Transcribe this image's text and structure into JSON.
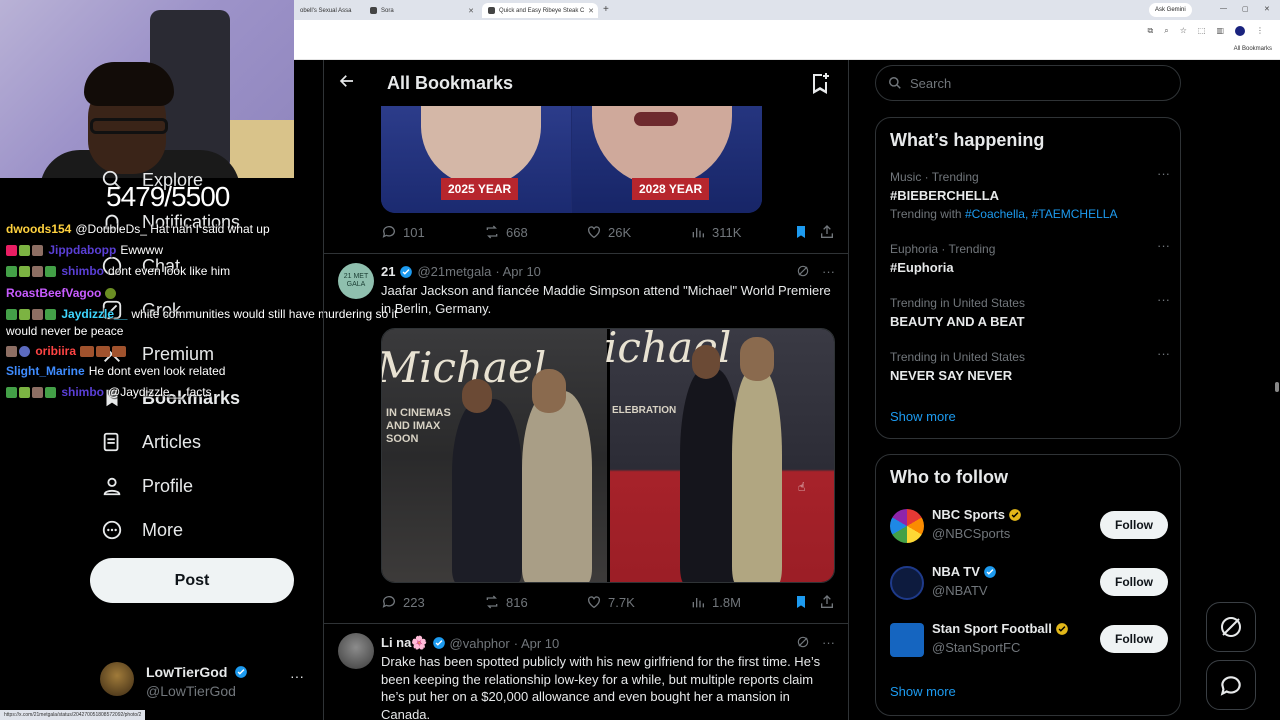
{
  "browser": {
    "tabs": [
      {
        "label": "obell's Sexual Assa"
      },
      {
        "label": "Sora"
      },
      {
        "label": "Quick and Easy Ribeye Steak C"
      }
    ],
    "new_tab_label": "+",
    "ask_gemini": "Ask Gemini",
    "all_bookmarks": "All Bookmarks",
    "status_url": "https://x.com/21metgala/status/204270051808572092/photo/2"
  },
  "stream": {
    "counter": "5479/5500",
    "chat": [
      {
        "user": "dwoods154",
        "user_color": "#ffd23f",
        "message": "@DoubleDs_ Hat nah I said what up"
      },
      {
        "user": "Jippdabopp",
        "user_color": "#5a3fd6",
        "message": "Ewwww"
      },
      {
        "user": "shimbo",
        "user_color": "#5a3fd6",
        "message": "dont even look like him"
      },
      {
        "user": "RoastBeefVagoo",
        "user_color": "#c85cff",
        "message": ""
      },
      {
        "user": "Jaydizzle__",
        "user_color": "#3fd6ff",
        "message": "white communities would still have murdering so it"
      },
      {
        "user": "",
        "user_color": "#ffffff",
        "message": "would never be peace"
      },
      {
        "user": "oribiira",
        "user_color": "#ff4444",
        "message": ""
      },
      {
        "user": "Slight_Marine",
        "user_color": "#3f8cff",
        "message": "He dont even look related"
      },
      {
        "user": "shimbo",
        "user_color": "#5a3fd6",
        "message": "@Jaydizzle__ facts"
      }
    ]
  },
  "nav": {
    "items": [
      {
        "label": "Explore",
        "icon": "search-icon"
      },
      {
        "label": "Notifications",
        "icon": "bell-icon"
      },
      {
        "label": "Chat",
        "icon": "chat-icon"
      },
      {
        "label": "Grok",
        "icon": "grok-icon"
      },
      {
        "label": "Premium",
        "icon": "x-logo-icon"
      },
      {
        "label": "Bookmarks",
        "icon": "bookmark-icon"
      },
      {
        "label": "Articles",
        "icon": "article-icon"
      },
      {
        "label": "Profile",
        "icon": "person-icon"
      },
      {
        "label": "More",
        "icon": "more-circle-icon"
      }
    ],
    "post_label": "Post",
    "account": {
      "name": "LowTierGod",
      "handle": "@LowTierGod",
      "more": "···"
    }
  },
  "main": {
    "title": "All Bookmarks",
    "first_post": {
      "year_left": "2025 YEAR",
      "year_right": "2028 YEAR",
      "replies": "101",
      "reposts": "668",
      "likes": "26K",
      "views": "311K"
    },
    "second_post": {
      "name": "21",
      "handle": "@21metgala",
      "date": "· Apr 10",
      "avatar_text": "21 MET GALA",
      "text": "Jaafar Jackson and fiancée Maddie Simpson attend \"Michael\" World Premiere in Berlin, Germany.",
      "photo_left_title": "Michael",
      "photo_left_caption": "IN CINEMAS AND IMAX SOON",
      "photo_right_title": "ichael",
      "photo_right_caption": "ELEBRATION",
      "replies": "223",
      "reposts": "816",
      "likes": "7.7K",
      "views": "1.8M"
    },
    "third_post": {
      "name": "Li na🌸",
      "handle": "@vahphor",
      "date": "· Apr 10",
      "text": "Drake has been spotted publicly with his new girlfriend for the first time. He’s been keeping the relationship low-key for a while, but multiple reports claim he’s put her on a $20,000 allowance and even bought her a mansion in Canada."
    }
  },
  "sidebar": {
    "search_placeholder": "Search",
    "happening_title": "What’s happening",
    "trends": [
      {
        "meta": "Music · Trending",
        "name": "#BIEBERCHELLA",
        "with_label": "Trending with",
        "with_tags": "#Coachella, #TAEMCHELLA"
      },
      {
        "meta": "Euphoria · Trending",
        "name": "#Euphoria"
      },
      {
        "meta": "Trending in United States",
        "name": "BEAUTY AND A BEAT"
      },
      {
        "meta": "Trending in United States",
        "name": "NEVER SAY NEVER"
      }
    ],
    "show_more": "Show more",
    "follow_title": "Who to follow",
    "follow": [
      {
        "name": "NBC Sports",
        "handle": "@NBCSports",
        "badge": "gold",
        "button": "Follow"
      },
      {
        "name": "NBA TV",
        "handle": "@NBATV",
        "badge": "blue",
        "button": "Follow"
      },
      {
        "name": "Stan Sport Football",
        "handle": "@StanSportFC",
        "badge": "gold",
        "button": "Follow"
      }
    ],
    "follow_show_more": "Show more"
  },
  "colors": {
    "accent": "#1d9bf0",
    "background": "#000000",
    "border": "#2f3336",
    "muted": "#71767b",
    "gold_badge": "#e2b719"
  }
}
